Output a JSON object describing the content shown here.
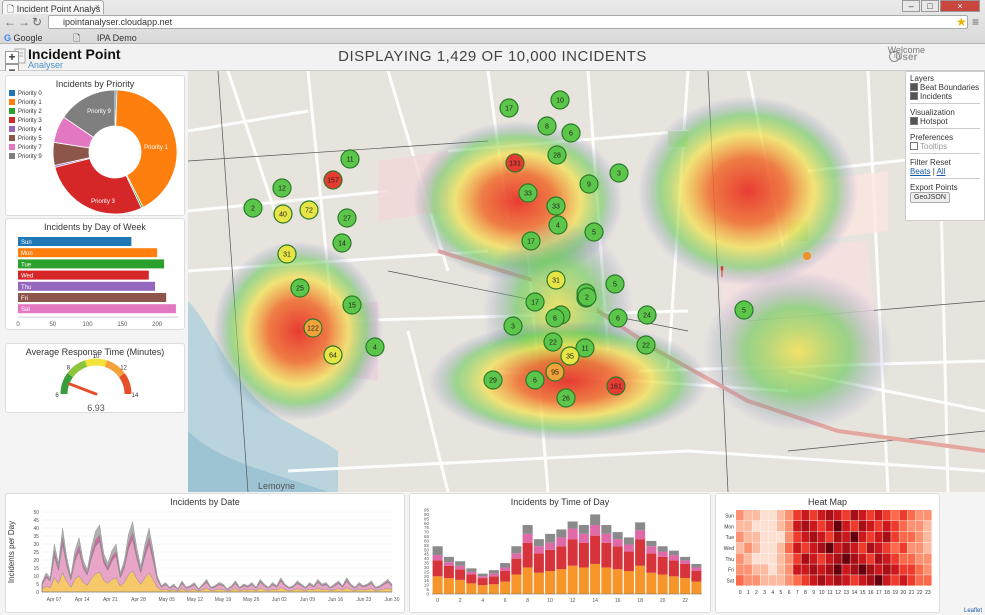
{
  "browser": {
    "tab_title": "Incident Point Analys",
    "url": "ipointanalyser.cloudapp.net",
    "bookmarks": [
      "Google",
      "IPA Demo"
    ]
  },
  "header": {
    "logo_title": "Incident Point",
    "logo_subtitle": "Analyser",
    "title": "DISPLAYING 1,429 OF 10,000 INCIDENTS",
    "welcome": "Welcome",
    "user": "User"
  },
  "priority_chart": {
    "title": "Incidents by Priority",
    "legend": [
      "Priority 0",
      "Priority 1",
      "Priority 2",
      "Priority 3",
      "Priority 4",
      "Priority 5",
      "Priority 7",
      "Priority 9"
    ],
    "colors": [
      "#1f77b4",
      "#ff7f0e",
      "#2ca02c",
      "#d62728",
      "#9467bd",
      "#8c564b",
      "#e377c2",
      "#7f7f7f"
    ],
    "slice_labels": [
      "Priority 1",
      "Priority 3",
      "Priority 9"
    ]
  },
  "day_chart": {
    "title": "Incidents by Day of Week",
    "days": [
      "Sun",
      "Mon",
      "Tue",
      "Wed",
      "Thu",
      "Fri",
      "Sat"
    ],
    "values": [
      163,
      200,
      210,
      188,
      197,
      213,
      227
    ],
    "colors": [
      "#1f77b4",
      "#ff7f0e",
      "#2ca02c",
      "#d62728",
      "#9467bd",
      "#8c564b",
      "#e377c2"
    ],
    "ticks": [
      "0",
      "50",
      "100",
      "150",
      "200"
    ]
  },
  "response_gauge": {
    "title": "Average Response Time (Minutes)",
    "ticks": [
      "6",
      "8",
      "10",
      "12",
      "14"
    ],
    "value": "6.93",
    "numeric_value": 6.93,
    "min": 6,
    "max": 14
  },
  "layers_panel": {
    "layers_heading": "Layers",
    "beat_boundaries": "Beat Boundaries",
    "incidents": "Incidents",
    "visualization_heading": "Visualization",
    "hotspot": "Hotspot",
    "preferences_heading": "Preferences",
    "tooltips": "Tooltips",
    "filter_reset_heading": "Filter Reset",
    "beats_link": "Beats",
    "separator": "|",
    "all_link": "All",
    "export_heading": "Export Points",
    "geojson_button": "GeoJSON"
  },
  "map": {
    "clusters": [
      "17",
      "10",
      "8",
      "6",
      "11",
      "157",
      "72",
      "40",
      "12",
      "2",
      "27",
      "28",
      "3",
      "131",
      "33",
      "9",
      "33",
      "4",
      "17",
      "5",
      "14",
      "31",
      "25",
      "15",
      "122",
      "64",
      "4",
      "31",
      "2",
      "17",
      "9",
      "3",
      "22",
      "11",
      "3",
      "6",
      "24",
      "5",
      "6",
      "22",
      "35",
      "29",
      "6",
      "95",
      "161",
      "26",
      "2",
      "5"
    ],
    "cluster_levels": [
      "g",
      "g",
      "g",
      "g",
      "g",
      "r",
      "y",
      "y",
      "g",
      "g",
      "g",
      "g",
      "g",
      "r",
      "g",
      "g",
      "g",
      "g",
      "g",
      "g",
      "g",
      "y",
      "g",
      "g",
      "o",
      "y",
      "g",
      "y",
      "g",
      "g",
      "g",
      "g",
      "g",
      "g",
      "g",
      "g",
      "g",
      "g",
      "g",
      "g",
      "y",
      "g",
      "g",
      "o",
      "r",
      "g",
      "g",
      "g"
    ],
    "road_labels": [
      "Lemoyne"
    ],
    "attribution": "Leaflet"
  },
  "chart_data": [
    {
      "type": "area",
      "title": "Incidents by Date",
      "ylabel": "Incidents per Day",
      "ylim": [
        0,
        50
      ],
      "ytick_labels": [
        "0",
        "5",
        "10",
        "15",
        "20",
        "25",
        "30",
        "35",
        "40",
        "45",
        "50"
      ],
      "xtick_labels": [
        "Apr 07",
        "Apr 14",
        "Apr 21",
        "Apr 28",
        "May 05",
        "May 12",
        "May 19",
        "May 26",
        "Jun 02",
        "Jun 09",
        "Jun 16",
        "Jun 23",
        "Jun 30"
      ],
      "values": [
        6,
        12,
        9,
        30,
        18,
        40,
        22,
        10,
        26,
        34,
        20,
        14,
        28,
        38,
        42,
        24,
        18,
        26,
        30,
        12,
        20,
        36,
        44,
        28,
        16,
        30,
        40,
        26,
        10,
        4,
        6,
        3,
        5,
        2,
        7,
        3,
        4,
        6,
        2,
        5,
        8,
        3,
        4,
        6,
        5,
        2,
        4,
        7,
        3,
        5,
        4,
        6,
        3,
        8,
        5,
        3,
        6,
        4,
        9,
        5,
        3,
        4,
        7,
        5,
        3,
        6,
        4,
        8,
        5,
        6,
        3,
        5,
        7,
        4,
        9,
        5,
        3,
        6,
        4,
        5,
        7,
        3,
        4,
        6,
        8,
        5
      ]
    },
    {
      "type": "bar",
      "title": "Incidents by Time of Day",
      "ylim": [
        0,
        95
      ],
      "ytick_labels": [
        "0",
        "5",
        "10",
        "15",
        "20",
        "25",
        "30",
        "35",
        "40",
        "45",
        "50",
        "55",
        "60",
        "65",
        "70",
        "75",
        "80",
        "85",
        "90",
        "95"
      ],
      "categories": [
        "0",
        "1",
        "2",
        "3",
        "4",
        "5",
        "6",
        "7",
        "8",
        "9",
        "10",
        "11",
        "12",
        "13",
        "14",
        "15",
        "16",
        "17",
        "18",
        "19",
        "20",
        "21",
        "22",
        "23"
      ],
      "xtick_labels": [
        "0",
        "2",
        "4",
        "6",
        "8",
        "10",
        "12",
        "14",
        "16",
        "18",
        "20",
        "22"
      ],
      "series": [
        {
          "name": "Priority 1",
          "values": [
            20,
            18,
            16,
            12,
            10,
            11,
            14,
            22,
            30,
            24,
            26,
            28,
            32,
            30,
            34,
            30,
            28,
            26,
            32,
            24,
            22,
            20,
            18,
            14
          ]
        },
        {
          "name": "Priority 3",
          "values": [
            18,
            14,
            12,
            10,
            8,
            9,
            12,
            18,
            28,
            22,
            24,
            26,
            30,
            28,
            32,
            28,
            26,
            22,
            30,
            22,
            20,
            18,
            16,
            12
          ]
        },
        {
          "name": "Priority 7",
          "values": [
            6,
            4,
            4,
            3,
            2,
            3,
            4,
            6,
            10,
            8,
            8,
            10,
            12,
            10,
            12,
            10,
            8,
            8,
            10,
            8,
            6,
            6,
            4,
            4
          ]
        },
        {
          "name": "Priority 9",
          "values": [
            10,
            6,
            5,
            4,
            3,
            4,
            5,
            8,
            10,
            8,
            10,
            9,
            8,
            10,
            12,
            10,
            8,
            8,
            9,
            6,
            6,
            5,
            4,
            4
          ]
        }
      ]
    },
    {
      "type": "heatmap",
      "title": "Heat Map",
      "rows": [
        "Sun",
        "Mon",
        "Tue",
        "Wed",
        "Thu",
        "Fri",
        "Sat"
      ],
      "columns": [
        "0",
        "1",
        "2",
        "3",
        "4",
        "5",
        "6",
        "7",
        "8",
        "9",
        "10",
        "11",
        "12",
        "13",
        "14",
        "15",
        "16",
        "17",
        "18",
        "19",
        "20",
        "21",
        "22",
        "23"
      ],
      "values": [
        [
          3,
          2,
          2,
          1,
          1,
          2,
          3,
          5,
          6,
          5,
          6,
          7,
          6,
          5,
          7,
          6,
          5,
          6,
          5,
          4,
          5,
          4,
          3,
          3
        ],
        [
          2,
          2,
          1,
          1,
          1,
          2,
          3,
          6,
          7,
          6,
          5,
          6,
          8,
          6,
          5,
          7,
          6,
          5,
          6,
          5,
          4,
          3,
          3,
          2
        ],
        [
          3,
          2,
          2,
          1,
          1,
          1,
          3,
          5,
          6,
          7,
          6,
          5,
          7,
          6,
          8,
          6,
          5,
          6,
          7,
          5,
          4,
          4,
          3,
          2
        ],
        [
          2,
          3,
          2,
          1,
          1,
          2,
          4,
          6,
          5,
          6,
          7,
          8,
          6,
          7,
          6,
          5,
          7,
          6,
          5,
          4,
          5,
          3,
          3,
          2
        ],
        [
          3,
          2,
          1,
          1,
          1,
          2,
          3,
          5,
          7,
          6,
          5,
          6,
          7,
          8,
          7,
          6,
          5,
          7,
          6,
          5,
          4,
          4,
          3,
          3
        ],
        [
          3,
          3,
          2,
          2,
          1,
          2,
          3,
          6,
          6,
          7,
          6,
          7,
          8,
          6,
          7,
          8,
          7,
          6,
          7,
          6,
          5,
          5,
          4,
          3
        ],
        [
          4,
          3,
          3,
          2,
          2,
          2,
          3,
          4,
          5,
          6,
          7,
          6,
          7,
          6,
          5,
          6,
          7,
          8,
          6,
          5,
          6,
          5,
          4,
          4
        ]
      ]
    }
  ]
}
